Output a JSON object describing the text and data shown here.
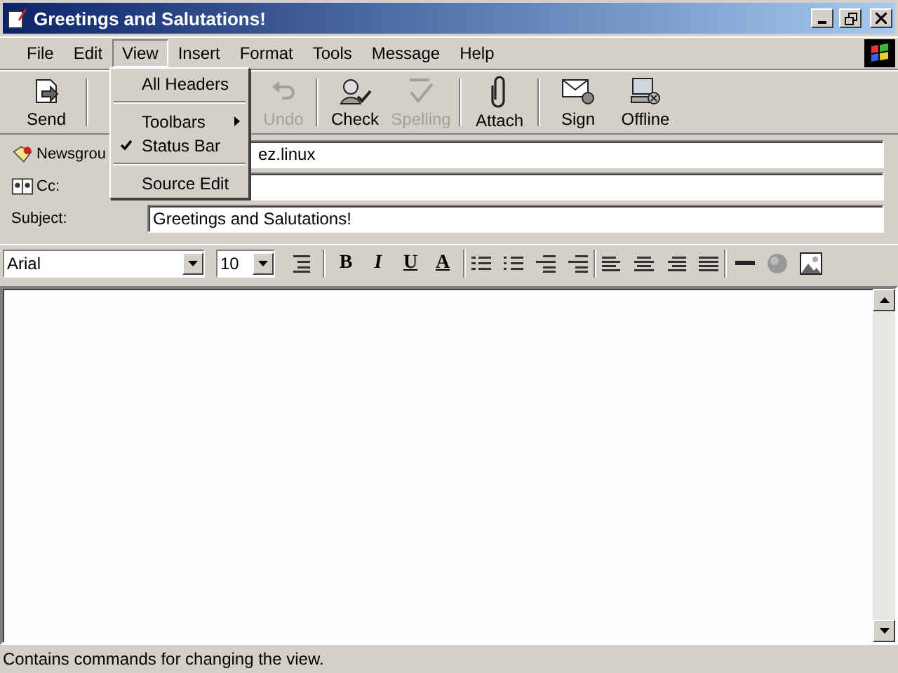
{
  "window": {
    "title": "Greetings and Salutations!"
  },
  "menu_bar": [
    {
      "label": "File",
      "selected": false
    },
    {
      "label": "Edit",
      "selected": false
    },
    {
      "label": "View",
      "selected": true
    },
    {
      "label": "Insert",
      "selected": false
    },
    {
      "label": "Format",
      "selected": false
    },
    {
      "label": "Tools",
      "selected": false
    },
    {
      "label": "Message",
      "selected": false
    },
    {
      "label": "Help",
      "selected": false
    }
  ],
  "view_menu": [
    {
      "kind": "item",
      "label": "All Headers"
    },
    {
      "kind": "separator"
    },
    {
      "kind": "submenu",
      "label": "Toolbars"
    },
    {
      "kind": "check",
      "label": "Status Bar",
      "checked": true
    },
    {
      "kind": "separator"
    },
    {
      "kind": "item",
      "label": "Source Edit"
    }
  ],
  "toolbar": [
    {
      "label": "Send",
      "disabled": false
    },
    {
      "label": "Undo",
      "disabled": true
    },
    {
      "label": "Check",
      "disabled": false
    },
    {
      "label": "Spelling",
      "disabled": true
    },
    {
      "label": "Attach",
      "disabled": false
    },
    {
      "label": "Sign",
      "disabled": false
    },
    {
      "label": "Offline",
      "disabled": false
    }
  ],
  "headers": [
    {
      "label": "Newsgrou",
      "value": "ez.linux"
    },
    {
      "label": "Cc:"
    },
    {
      "label": "Subject:",
      "value": "Greetings and Salutations!"
    }
  ],
  "format_bar": {
    "font": "Arial",
    "size": "10",
    "bold": "B",
    "italic": "I",
    "underline": "U",
    "font_color": "A"
  },
  "status_bar": {
    "text": "Contains commands for changing the view."
  }
}
